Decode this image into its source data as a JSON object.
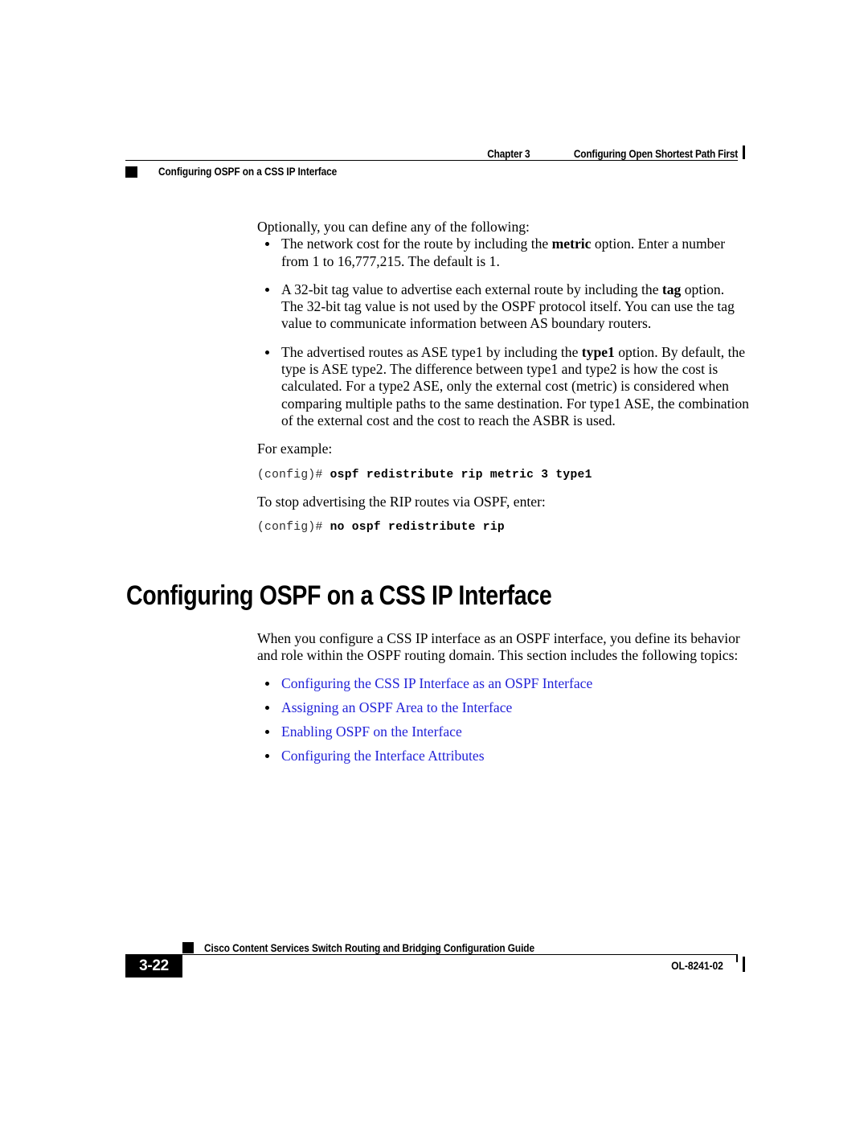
{
  "header": {
    "chapter_label": "Chapter 3",
    "chapter_title": "Configuring Open Shortest Path First",
    "section_title": "Configuring OSPF on a CSS IP Interface"
  },
  "content": {
    "intro_paragraph": "Optionally, you can define any of the following:",
    "option_bullets": [
      {
        "pre": "The network cost for the route by including the ",
        "bold": "metric",
        "post": " option. Enter a number from 1 to 16,777,215. The default is 1."
      },
      {
        "pre": "A 32-bit tag value to advertise each external route by including the ",
        "bold": "tag",
        "post": " option. The 32-bit tag value is not used by the OSPF protocol itself. You can use the tag value to communicate information between AS boundary routers."
      },
      {
        "pre": "The advertised routes as ASE type1 by including the ",
        "bold": "type1",
        "post": " option. By default, the type is ASE type2. The difference between type1 and type2 is how the cost is calculated. For a type2 ASE, only the external cost (metric) is considered when comparing multiple paths to the same destination. For type1 ASE, the combination of the external cost and the cost to reach the ASBR is used."
      }
    ],
    "for_example_label": "For example:",
    "cli_example_1": {
      "prompt": "(config)# ",
      "command": "ospf redistribute rip metric 3 type1"
    },
    "stop_advertising_label": "To stop advertising the RIP routes via OSPF, enter:",
    "cli_example_2": {
      "prompt": "(config)# ",
      "command": "no ospf redistribute rip"
    }
  },
  "section": {
    "heading": "Configuring OSPF on a CSS IP Interface",
    "intro_paragraph": "When you configure a CSS IP interface as an OSPF interface, you define its behavior and role within the OSPF routing domain. This section includes the following topics:",
    "topic_links": [
      "Configuring the CSS IP Interface as an OSPF Interface",
      "Assigning an OSPF Area to the Interface",
      "Enabling OSPF on the Interface",
      "Configuring the Interface Attributes"
    ]
  },
  "footer": {
    "guide_title": "Cisco Content Services Switch Routing and Bridging Configuration Guide",
    "page_number": "3-22",
    "doc_number": "OL-8241-02"
  },
  "colors": {
    "link_blue": "#2222d8",
    "text_black": "#000000"
  }
}
